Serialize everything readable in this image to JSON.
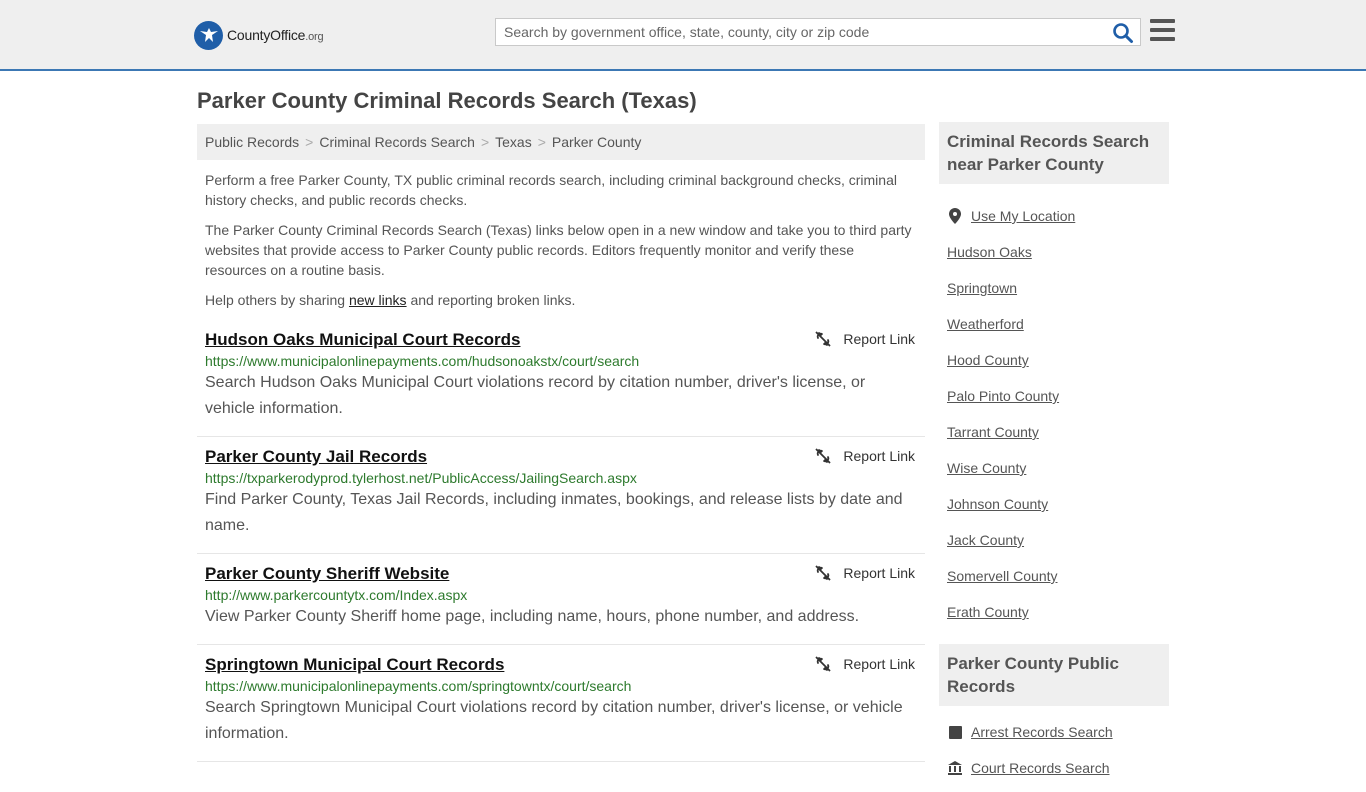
{
  "header": {
    "logo_main": "CountyOffice",
    "logo_suffix": ".org",
    "search_placeholder": "Search by government office, state, county, city or zip code"
  },
  "page": {
    "title": "Parker County Criminal Records Search (Texas)"
  },
  "breadcrumb": [
    "Public Records",
    "Criminal Records Search",
    "Texas",
    "Parker County"
  ],
  "intro": {
    "p1": "Perform a free Parker County, TX public criminal records search, including criminal background checks, criminal history checks, and public records checks.",
    "p2": "The Parker County Criminal Records Search (Texas) links below open in a new window and take you to third party websites that provide access to Parker County public records. Editors frequently monitor and verify these resources on a routine basis.",
    "p3_before": "Help others by sharing ",
    "p3_link": "new links",
    "p3_after": " and reporting broken links."
  },
  "report_label": "Report Link",
  "results": [
    {
      "title": "Hudson Oaks Municipal Court Records",
      "url": "https://www.municipalonlinepayments.com/hudsonoakstx/court/search",
      "desc": "Search Hudson Oaks Municipal Court violations record by citation number, driver's license, or vehicle information."
    },
    {
      "title": "Parker County Jail Records",
      "url": "https://txparkerodyprod.tylerhost.net/PublicAccess/JailingSearch.aspx",
      "desc": "Find Parker County, Texas Jail Records, including inmates, bookings, and release lists by date and name."
    },
    {
      "title": "Parker County Sheriff Website",
      "url": "http://www.parkercountytx.com/Index.aspx",
      "desc": "View Parker County Sheriff home page, including name, hours, phone number, and address."
    },
    {
      "title": "Springtown Municipal Court Records",
      "url": "https://www.municipalonlinepayments.com/springtowntx/court/search",
      "desc": "Search Springtown Municipal Court violations record by citation number, driver's license, or vehicle information."
    }
  ],
  "sidebar": {
    "nearby_title": "Criminal Records Search near Parker County",
    "use_location": "Use My Location",
    "nearby": [
      "Hudson Oaks",
      "Springtown",
      "Weatherford",
      "Hood County",
      "Palo Pinto County",
      "Tarrant County",
      "Wise County",
      "Johnson County",
      "Jack County",
      "Somervell County",
      "Erath County"
    ],
    "records_title": "Parker County Public Records",
    "records": [
      "Arrest Records Search",
      "Court Records Search"
    ]
  }
}
